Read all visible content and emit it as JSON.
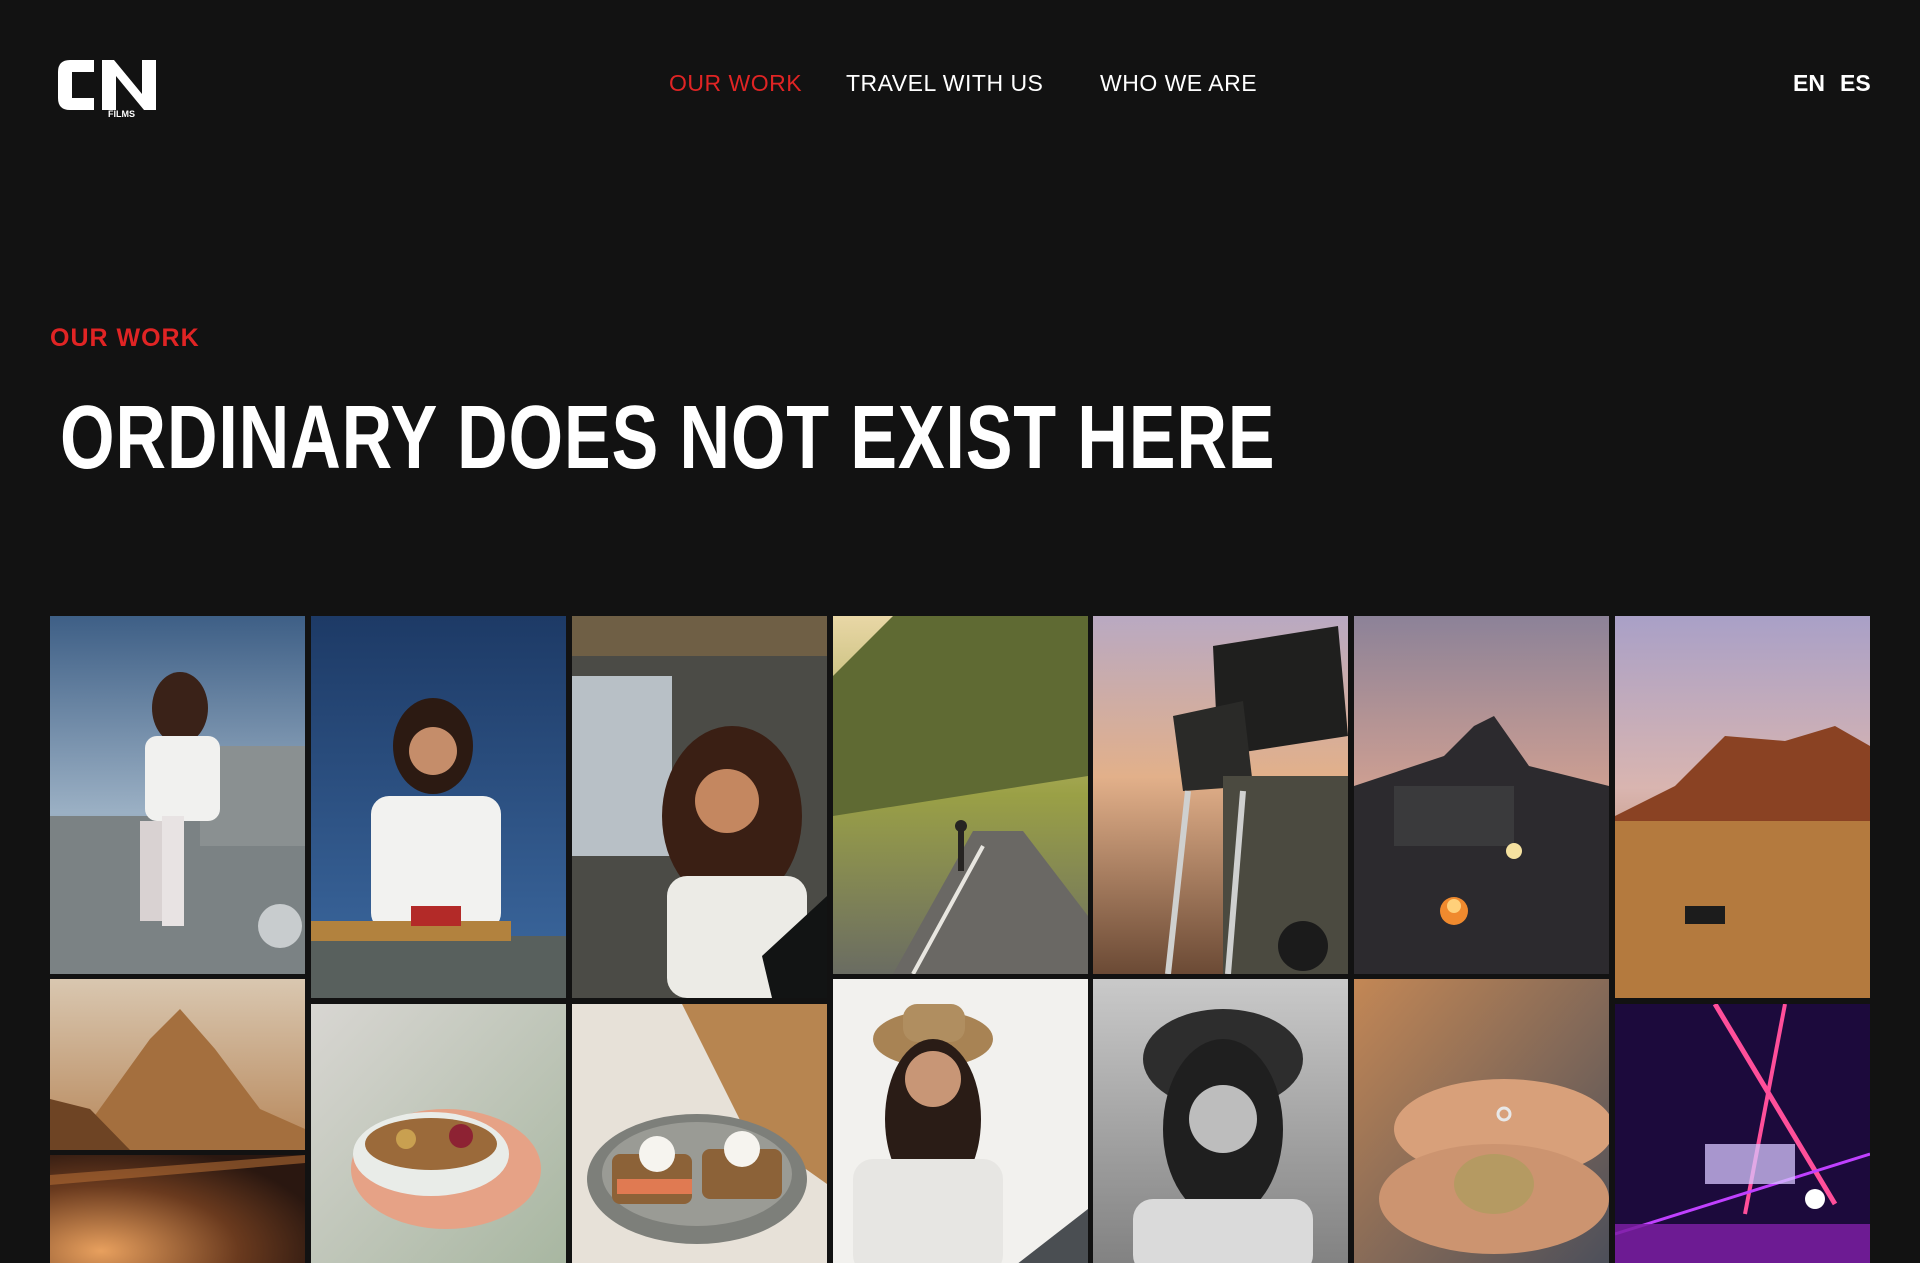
{
  "header": {
    "logo": {
      "text": "CN",
      "subtext": "FILMS"
    },
    "nav": [
      {
        "label": "OUR WORK",
        "active": true
      },
      {
        "label": "TRAVEL WITH US",
        "active": false
      },
      {
        "label": "WHO WE ARE",
        "active": false
      }
    ],
    "languages": [
      "EN",
      "ES"
    ]
  },
  "hero": {
    "eyebrow": "OUR WORK",
    "headline": "ORDINARY DOES NOT EXIST HERE"
  },
  "colors": {
    "background": "#121212",
    "accent": "#e02424",
    "text": "#ffffff"
  },
  "gallery": {
    "tiles": [
      {
        "subject": "woman sitting on vintage land rover hood"
      },
      {
        "subject": "woman in glasses standing in vehicle"
      },
      {
        "subject": "curly-haired woman in car seat"
      },
      {
        "subject": "person on mountain road at sunset"
      },
      {
        "subject": "rooftop tent on off-road vehicle"
      },
      {
        "subject": "camp with fire beneath mountain at dusk"
      },
      {
        "subject": "desert with red rock mountains"
      },
      {
        "subject": "golden mountain peak"
      },
      {
        "subject": "hands holding acai bowl"
      },
      {
        "subject": "avocado toast with poached eggs"
      },
      {
        "subject": "woman in straw hat"
      },
      {
        "subject": "black and white portrait with knit hat"
      },
      {
        "subject": "hands holding sea urchin shell"
      },
      {
        "subject": "concert stage with pink lasers"
      },
      {
        "subject": "stage lights warm haze"
      }
    ]
  }
}
